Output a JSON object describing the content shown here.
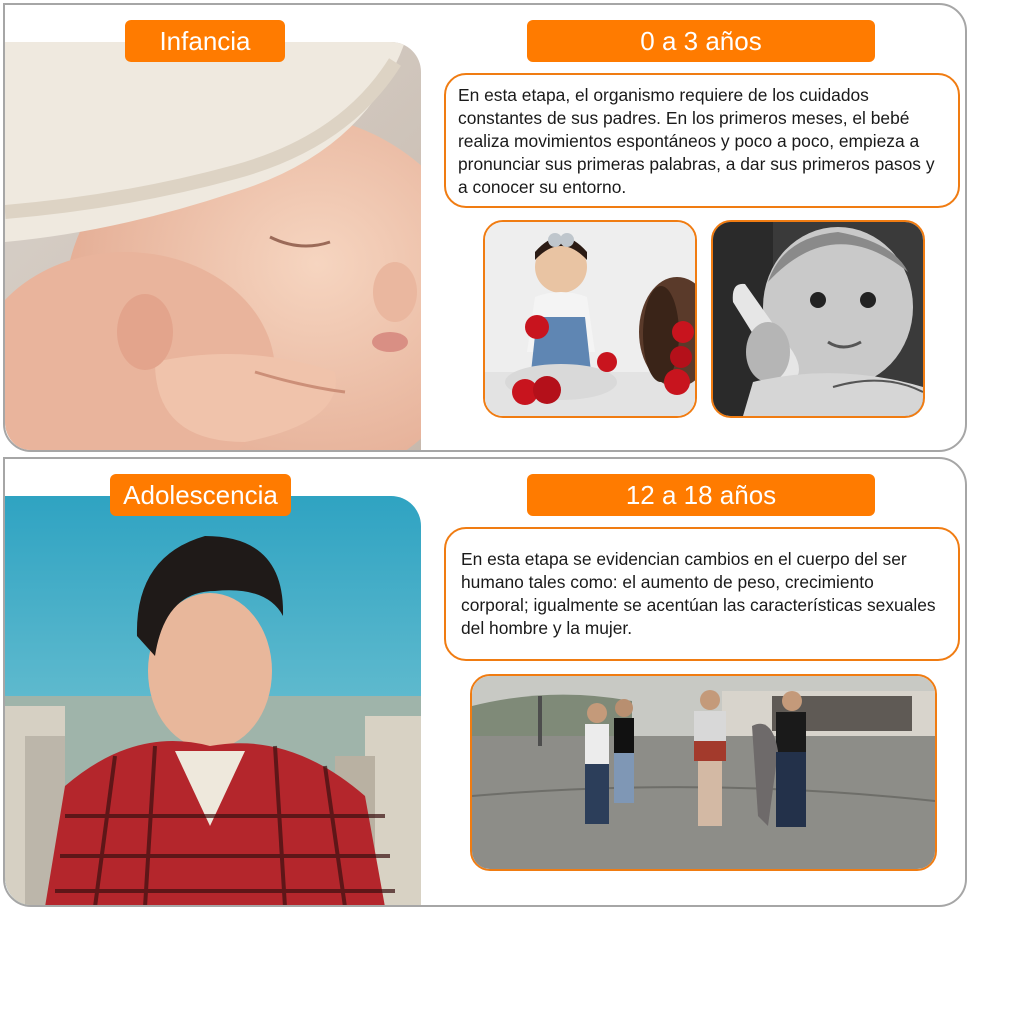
{
  "sections": [
    {
      "label": "Infancia",
      "age_range": "0 a 3 años",
      "description": "En esta etapa, el organismo requiere de los cuidados constantes de sus padres. En los primeros meses, el bebé realiza movimientos espontáneos y poco a poco, empieza a pronunciar sus primeras palabras, a dar sus primeros pasos y a conocer su entorno."
    },
    {
      "label": "Adolescencia",
      "age_range": "12 a 18 años",
      "description": "En esta etapa se evidencian cambios en el cuerpo del ser humano tales como: el aumento de peso, crecimiento corporal; igualmente se acentúan las características sexuales del hombre y la mujer."
    }
  ],
  "colors": {
    "accent": "#ff7b00",
    "border": "#f07c12",
    "card_border": "#a6a6a6"
  }
}
